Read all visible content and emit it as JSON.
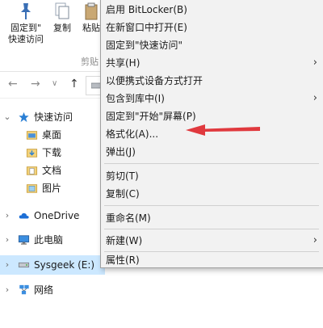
{
  "ribbon": {
    "pin_label_line1": "固定到\"",
    "pin_label_line2": "快速访问",
    "copy_label": "复制",
    "paste_label": "粘贴",
    "clipboard_group": "剪贴"
  },
  "nav": {
    "items": [
      {
        "label": "快速访问",
        "icon": "star-icon"
      },
      {
        "label": "桌面",
        "icon": "desktop-folder-icon"
      },
      {
        "label": "下载",
        "icon": "downloads-folder-icon"
      },
      {
        "label": "文档",
        "icon": "documents-folder-icon"
      },
      {
        "label": "图片",
        "icon": "pictures-folder-icon"
      },
      {
        "label": "OneDrive",
        "icon": "cloud-icon"
      },
      {
        "label": "此电脑",
        "icon": "computer-icon"
      },
      {
        "label": "Sysgeek (E:)",
        "icon": "usb-drive-icon"
      },
      {
        "label": "网络",
        "icon": "network-icon"
      }
    ]
  },
  "menu": {
    "items": [
      {
        "label": "启用 BitLocker(B)"
      },
      {
        "label": "在新窗口中打开(E)"
      },
      {
        "label": "固定到\"快速访问\""
      },
      {
        "label": "共享(H)",
        "arrow": "›"
      },
      {
        "label": "以便携式设备方式打开"
      },
      {
        "label": "包含到库中(I)",
        "arrow": "›"
      },
      {
        "label": "固定到\"开始\"屏幕(P)"
      },
      {
        "label": "格式化(A)..."
      },
      {
        "label": "弹出(J)"
      },
      {
        "label": "剪切(T)"
      },
      {
        "label": "复制(C)"
      },
      {
        "label": "重命名(M)"
      },
      {
        "label": "新建(W)",
        "arrow": "›"
      },
      {
        "label": "属性(R)"
      }
    ]
  },
  "colors": {
    "selection": "#cce8ff",
    "menu_bg": "#f2f2f2",
    "annotation_arrow": "#e0393e"
  }
}
